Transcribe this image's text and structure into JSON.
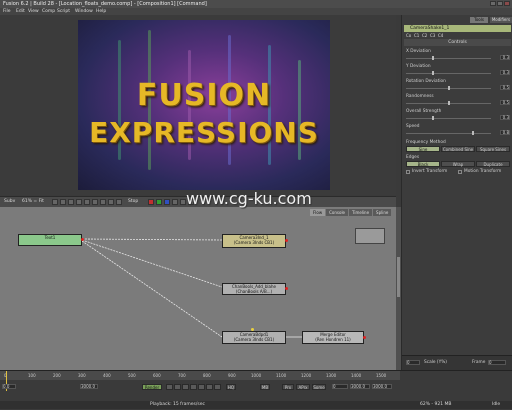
{
  "window": {
    "title": "Fusion 6.2 | Build 28 - [Location_floats_demo.comp] - [Composition1] [Command]"
  },
  "menu": [
    "File",
    "Edit",
    "View",
    "Comp",
    "Script",
    "Window",
    "Help"
  ],
  "viewer": {
    "line1": "FUSION",
    "line2": "EXPRESSIONS"
  },
  "viewer_toolbar": {
    "zoom": "Subv",
    "scale": "61% = Fit",
    "field": "Stop"
  },
  "flow": {
    "tabs": [
      "Flow",
      "Console",
      "Timeline",
      "Spline"
    ],
    "active_tab": "Flow",
    "watermark": "www.cg-ku.com",
    "nodes": {
      "text": {
        "line1": "Text1",
        "line2": "(Text+ Text1)"
      },
      "camera": {
        "line1": "Camera3Ind_1",
        "line2": "(Camera 3Inds CB1)"
      },
      "chanbools": {
        "line1": "ChanBools_Add_blahe",
        "line2": "(ChanBools A/B...)"
      },
      "camera2": {
        "line1": "CameraBdpd1",
        "line2": "(Camera 3Inds CB1)"
      },
      "merge": {
        "line1": "Merge Editor",
        "line2": "(Ren Hondren 11)"
      }
    }
  },
  "panel": {
    "tabs": [
      "Tools",
      "Modifiers"
    ],
    "tool_name": "CameraShake1_1",
    "subtabs": [
      "Co",
      "C1",
      "C2",
      "C3",
      "C4"
    ],
    "section": "Controls",
    "params": [
      {
        "label": "X Deviation",
        "value": "0.3"
      },
      {
        "label": "Y Deviation",
        "value": "0.3"
      },
      {
        "label": "Rotation Deviation",
        "value": "0.5"
      },
      {
        "label": "Randomness",
        "value": "0.5"
      },
      {
        "label": "Overall Strength",
        "value": "0.3"
      },
      {
        "label": "Speed",
        "value": "0.8"
      }
    ],
    "freq_label": "Frequency Method",
    "freq_options": [
      "Sine",
      "Combined Sine",
      "Square Sines"
    ],
    "edges_label": "Edges",
    "edges_options": [
      "Black",
      "Wrap",
      "Duplicate"
    ],
    "invert_label": "Invert Transform",
    "motion_label": "Motion Transform",
    "frame_label": "Frame",
    "frame_value": "0",
    "scale_label": "Scale (Y%)",
    "scale_value": "0"
  },
  "timeline": {
    "ticks": [
      "0",
      "100",
      "200",
      "300",
      "400",
      "500",
      "600",
      "700",
      "800",
      "900",
      "1000",
      "1100",
      "1200",
      "1300",
      "1400",
      "1500"
    ],
    "start": "0.0",
    "end": "3000.0",
    "render_label": "Render",
    "hq_label": "HQ",
    "mb_label": "MB",
    "prx_label": "Prx",
    "aprx_label": "APrx",
    "some_label": "Some",
    "current": "0",
    "end2": "3000.0",
    "end3": "3000.0"
  },
  "status": {
    "left": "Playback: 15 frames/sec",
    "right": "62% - 921 MB",
    "idle": "Idle"
  }
}
